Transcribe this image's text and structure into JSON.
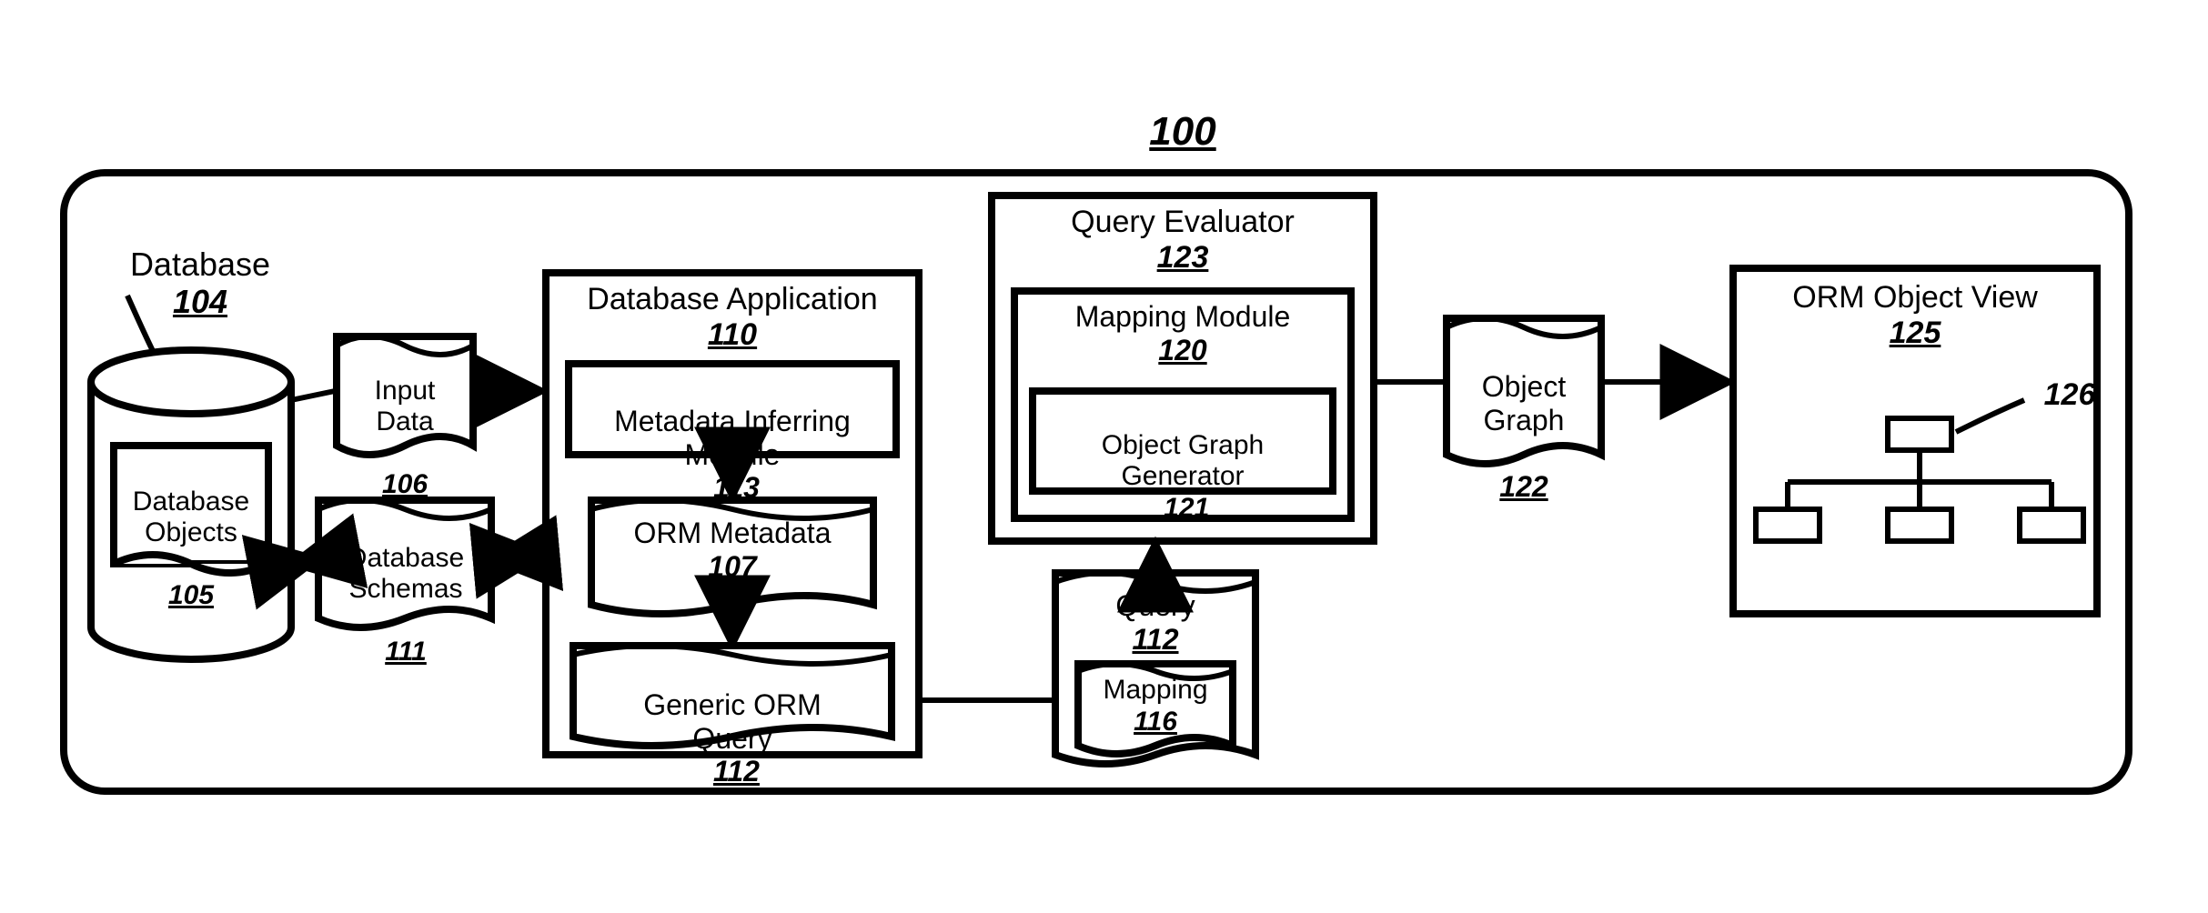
{
  "figure_number": "100",
  "database": {
    "label": "Database",
    "ref": "104"
  },
  "db_objects": {
    "label": "Database\nObjects",
    "ref": "105"
  },
  "input_data": {
    "label": "Input\nData",
    "ref": "106"
  },
  "db_schemas": {
    "label": "Database\nSchemas",
    "ref": "111"
  },
  "db_app": {
    "label": "Database Application",
    "ref": "110"
  },
  "metadata_inferring": {
    "label": "Metadata Inferring\nModule",
    "ref": "113"
  },
  "orm_metadata": {
    "label": "ORM Metadata",
    "ref": "107"
  },
  "generic_orm_query": {
    "label": "Generic ORM\nQuery",
    "ref": "112"
  },
  "query_evaluator": {
    "label": "Query Evaluator",
    "ref": "123"
  },
  "mapping_module": {
    "label": "Mapping Module",
    "ref": "120"
  },
  "obj_graph_gen": {
    "label": "Object Graph\nGenerator",
    "ref": "121"
  },
  "query_doc": {
    "label": "Query",
    "ref": "112"
  },
  "mapping_doc": {
    "label": "Mapping",
    "ref": "116"
  },
  "object_graph": {
    "label": "Object\nGraph",
    "ref": "122"
  },
  "orm_view": {
    "label": "ORM Object View",
    "ref": "125"
  },
  "orm_tree_ref": "126"
}
